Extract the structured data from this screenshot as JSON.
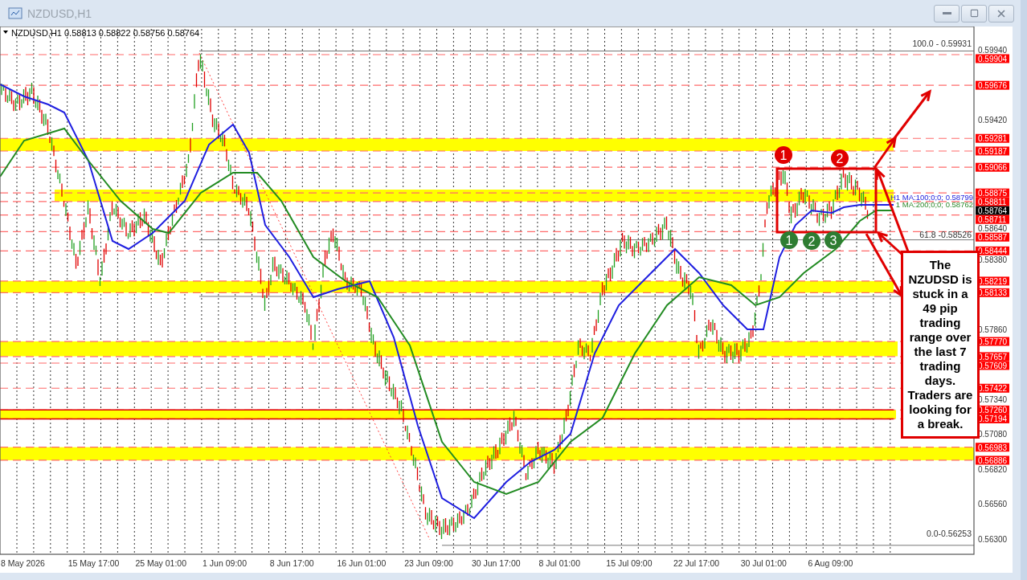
{
  "window": {
    "title": "NZDUSD,H1"
  },
  "chart": {
    "symbol": "NZDUSD,H1",
    "quote": [
      "0.58813",
      "0.58822",
      "0.58756",
      "0.58764"
    ],
    "fib_labels": [
      "100.0 - 0.59931",
      "61.8 -0.58526",
      "0.0-0.56253"
    ],
    "ma_labels": [
      "H1 MA:100;0;0; 0.58799",
      "1 MA:200;0;0; 0.58762"
    ],
    "price_ticks": [
      "0.59940",
      "0.59420",
      "0.58640",
      "0.58380",
      "0.57860",
      "0.57340",
      "0.57080",
      "0.56820",
      "0.56560",
      "0.56300"
    ],
    "levels": [
      "0.59904",
      "0.59676",
      "0.59281",
      "0.59187",
      "0.59066",
      "0.58875",
      "0.58811",
      "0.58711",
      "0.58587",
      "0.58444",
      "0.58219",
      "0.58133",
      "0.57770",
      "0.57657",
      "0.57609",
      "0.57422",
      "0.57260",
      "0.57194",
      "0.56983",
      "0.56886"
    ],
    "current_price": "0.58764",
    "time_ticks": [
      "8 May 2026",
      "15 May 17:00",
      "25 May 01:00",
      "1 Jun 09:00",
      "8 Jun 17:00",
      "16 Jun 01:00",
      "23 Jun 09:00",
      "30 Jun 17:00",
      "8 Jul 01:00",
      "15 Jul 09:00",
      "22 Jul 17:00",
      "30 Jul 01:00",
      "6 Aug 09:00"
    ],
    "markers": [
      {
        "label": "1",
        "color": "#e00000"
      },
      {
        "label": "2",
        "color": "#e00000"
      },
      {
        "label": "1",
        "color": "#2e7d32"
      },
      {
        "label": "2",
        "color": "#2e7d32"
      },
      {
        "label": "3",
        "color": "#2e7d32"
      }
    ],
    "note": "The NZUDSD is stuck in a 49 pip trading range over the last 7 trading days. Traders are looking for a break."
  }
}
